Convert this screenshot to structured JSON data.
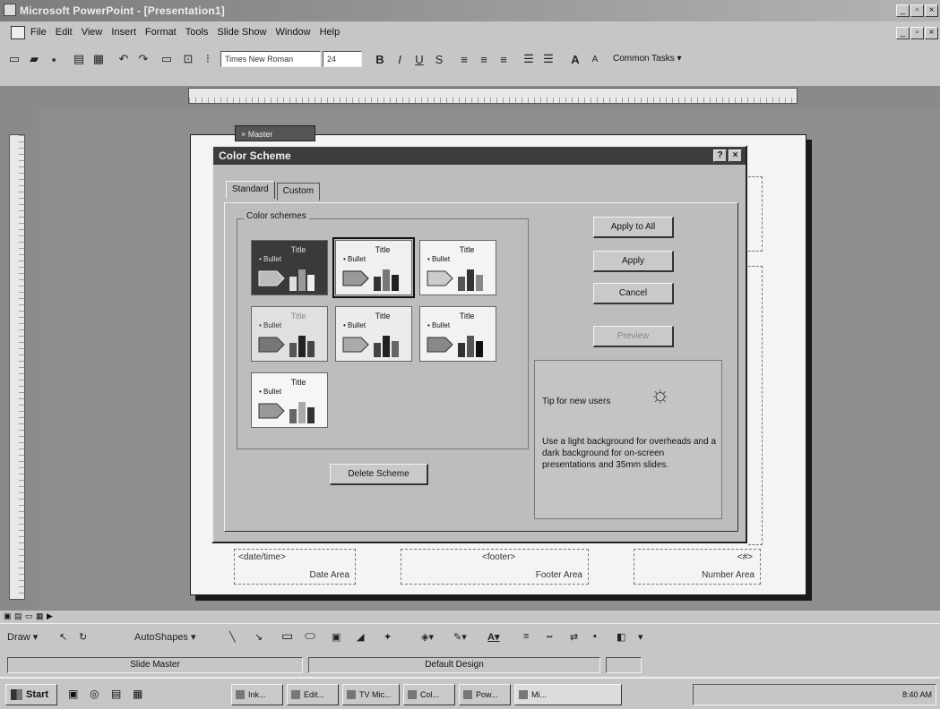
{
  "app": {
    "title": "Microsoft PowerPoint - [Presentation1]",
    "colors": {
      "title_bar": "#8c8c8c",
      "dialog_title": "#3d3d3d",
      "face": "#c6c6c6"
    }
  },
  "menu": {
    "items": [
      "File",
      "Edit",
      "View",
      "Insert",
      "Format",
      "Tools",
      "Slide Show",
      "Window",
      "Help"
    ]
  },
  "toolbar": {
    "font": "Times New Roman",
    "size": "24",
    "bold": "B",
    "italic": "I",
    "underline": "U",
    "shadow": "S",
    "common_tasks": "Common Tasks ▾"
  },
  "master_tool": {
    "label": "× Master"
  },
  "dialog": {
    "title": "Color Scheme",
    "tabs": [
      "Standard",
      "Custom"
    ],
    "group_label": "Color schemes",
    "swatch_title": "Title",
    "swatch_bullet": "• Bullet",
    "buttons": {
      "apply_all": "Apply to All",
      "apply": "Apply",
      "cancel": "Cancel",
      "preview": "Preview",
      "delete": "Delete Scheme"
    },
    "tip": {
      "heading": "Tip for new users",
      "body": "Use a light background for overheads and a dark background for on-screen presentations and 35mm slides."
    }
  },
  "slide": {
    "date_label": "<date/time>",
    "date_area": "Date Area",
    "footer_label": "<footer>",
    "footer_area": "Footer Area",
    "number_label": "<#>",
    "number_area": "Number Area"
  },
  "drawing": {
    "draw": "Draw ▾",
    "autoshapes": "AutoShapes ▾"
  },
  "status": {
    "view": "Slide Master",
    "design": "Default Design"
  },
  "taskbar": {
    "start": "Start",
    "tasks": [
      "Ink...",
      "Edit...",
      "TV Mic...",
      "Col...",
      "Pow...",
      "Mi..."
    ],
    "tray_time": "8:40 AM"
  }
}
